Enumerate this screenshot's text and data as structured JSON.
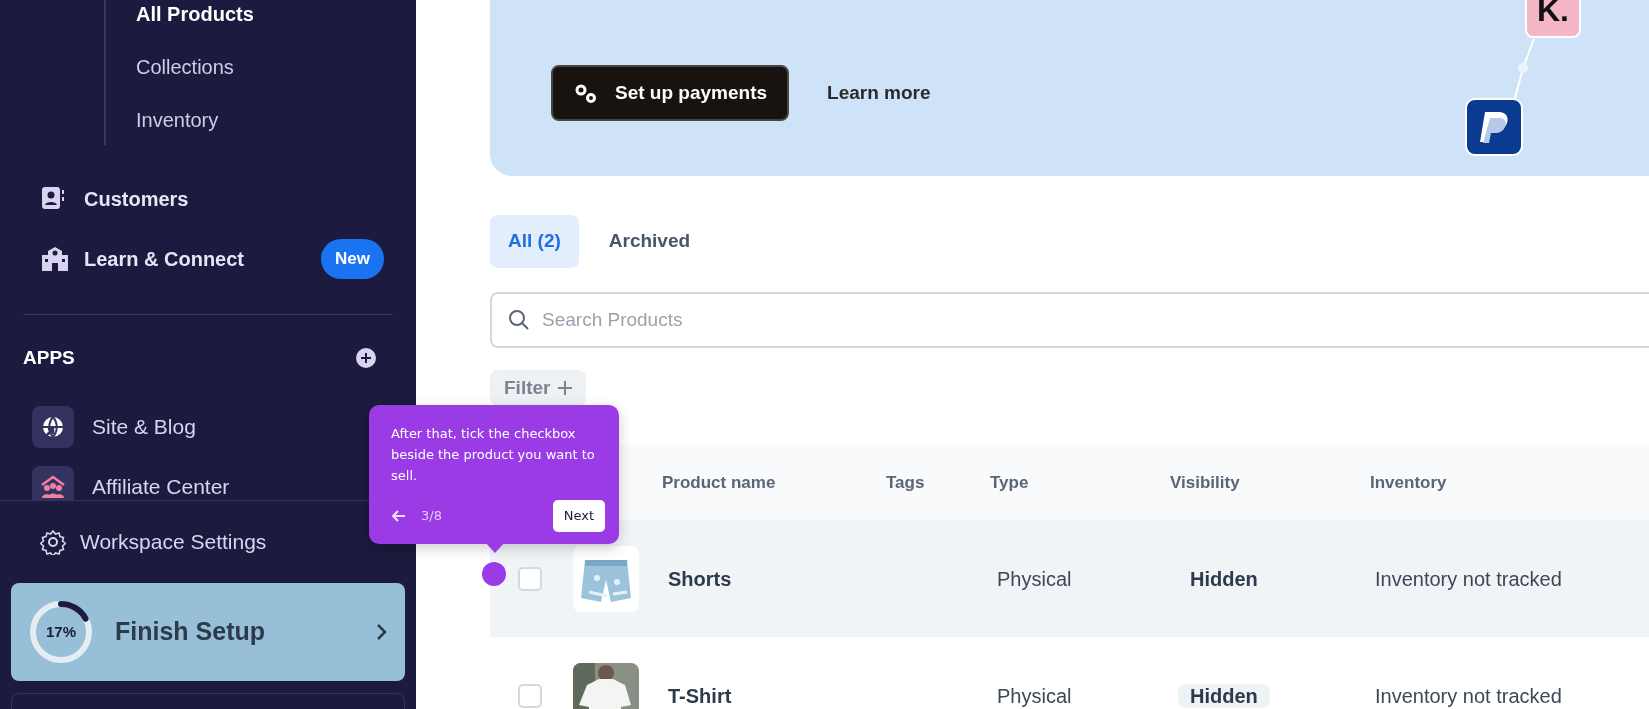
{
  "sidebar": {
    "product_subitems": [
      {
        "label": "All Products",
        "selected": true
      },
      {
        "label": "Collections",
        "selected": false
      },
      {
        "label": "Inventory",
        "selected": false
      }
    ],
    "nav_items": [
      {
        "kind": "customers",
        "label": "Customers"
      },
      {
        "kind": "learn",
        "label": "Learn & Connect",
        "badge": "New"
      }
    ],
    "apps_heading": "APPS",
    "apps": [
      {
        "kind": "site",
        "label": "Site & Blog"
      },
      {
        "kind": "affiliate",
        "label": "Affiliate Center"
      }
    ],
    "settings": "Workspace Settings",
    "setup": {
      "label": "Finish Setup",
      "percent": "17%",
      "level": 0.17
    }
  },
  "banner": {
    "button": "Set up payments",
    "link": "Learn more",
    "logo_text": "K."
  },
  "tabs": [
    {
      "label": "All (2)",
      "selected": true
    },
    {
      "label": "Archived",
      "selected": false
    }
  ],
  "search": {
    "placeholder": "Search Products"
  },
  "filter": {
    "label": "Filter"
  },
  "table": {
    "columns": [
      "Product name",
      "Tags",
      "Type",
      "Visibility",
      "Inventory"
    ],
    "rows": [
      {
        "kind": "shorts",
        "name": "Shorts",
        "type": "Physical",
        "visibility": "Hidden",
        "inventory": "Inventory not tracked",
        "checked": false,
        "hovered": true,
        "visibility_highlighted": false
      },
      {
        "kind": "tshirt",
        "name": "T-Shirt",
        "type": "Physical",
        "visibility": "Hidden",
        "inventory": "Inventory not tracked",
        "checked": false,
        "hovered": false,
        "visibility_highlighted": true
      }
    ]
  },
  "tour": {
    "text": "After that, tick the checkbox beside the product you want to sell.",
    "step": "3/8",
    "next": "Next"
  }
}
